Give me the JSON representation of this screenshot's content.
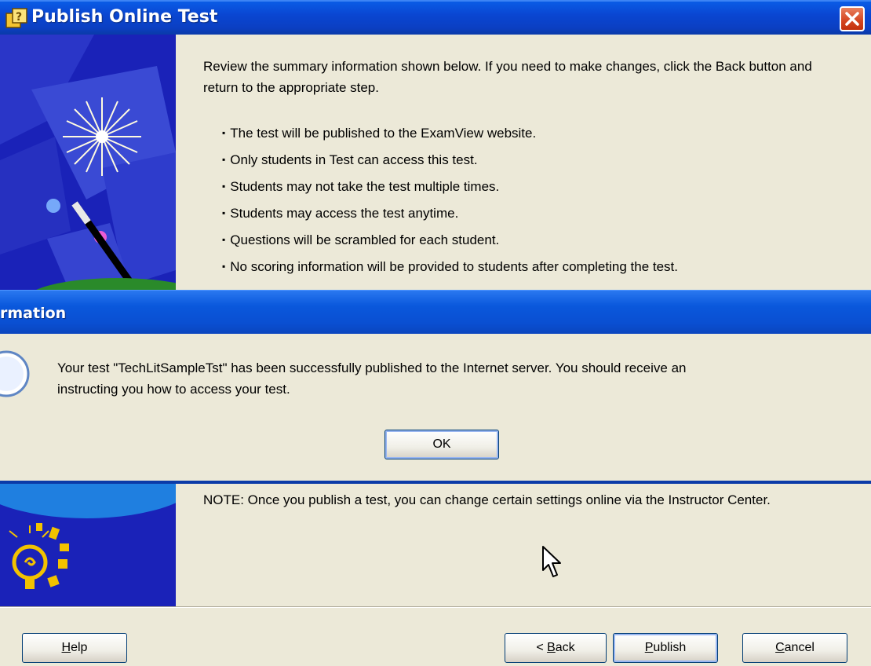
{
  "window": {
    "title": "Publish Online Test"
  },
  "summary": {
    "intro": "Review the summary information shown below.  If you need to make changes, click the Back button and return to the appropriate step.",
    "items": [
      "The test will be published to the ExamView website.",
      "Only students in Test can access this test.",
      "Students may not take the test multiple times.",
      "Students may access the test anytime.",
      "Questions will be scrambled for each student.",
      "No scoring information will be provided to students after completing the test."
    ],
    "note": "NOTE: Once you publish a test, you can change certain settings online via the Instructor Center."
  },
  "message_box": {
    "title": "rmation",
    "line1": "Your test \"TechLitSampleTst\" has been successfully published to the Internet server.  You should receive an",
    "line2": "instructing you how to access your test.",
    "ok_label": "OK"
  },
  "buttons": {
    "help": {
      "mnemonic": "H",
      "rest": "elp"
    },
    "back": {
      "prefix": "< ",
      "mnemonic": "B",
      "rest": "ack"
    },
    "publish": {
      "mnemonic": "P",
      "rest": "ublish"
    },
    "cancel": {
      "mnemonic": "C",
      "rest": "ancel"
    }
  },
  "icons": {
    "title_icon": "publish-wizard-icon",
    "close_icon": "close-icon",
    "message_icon": "information-icon",
    "cursor": "mouse-pointer-icon"
  }
}
